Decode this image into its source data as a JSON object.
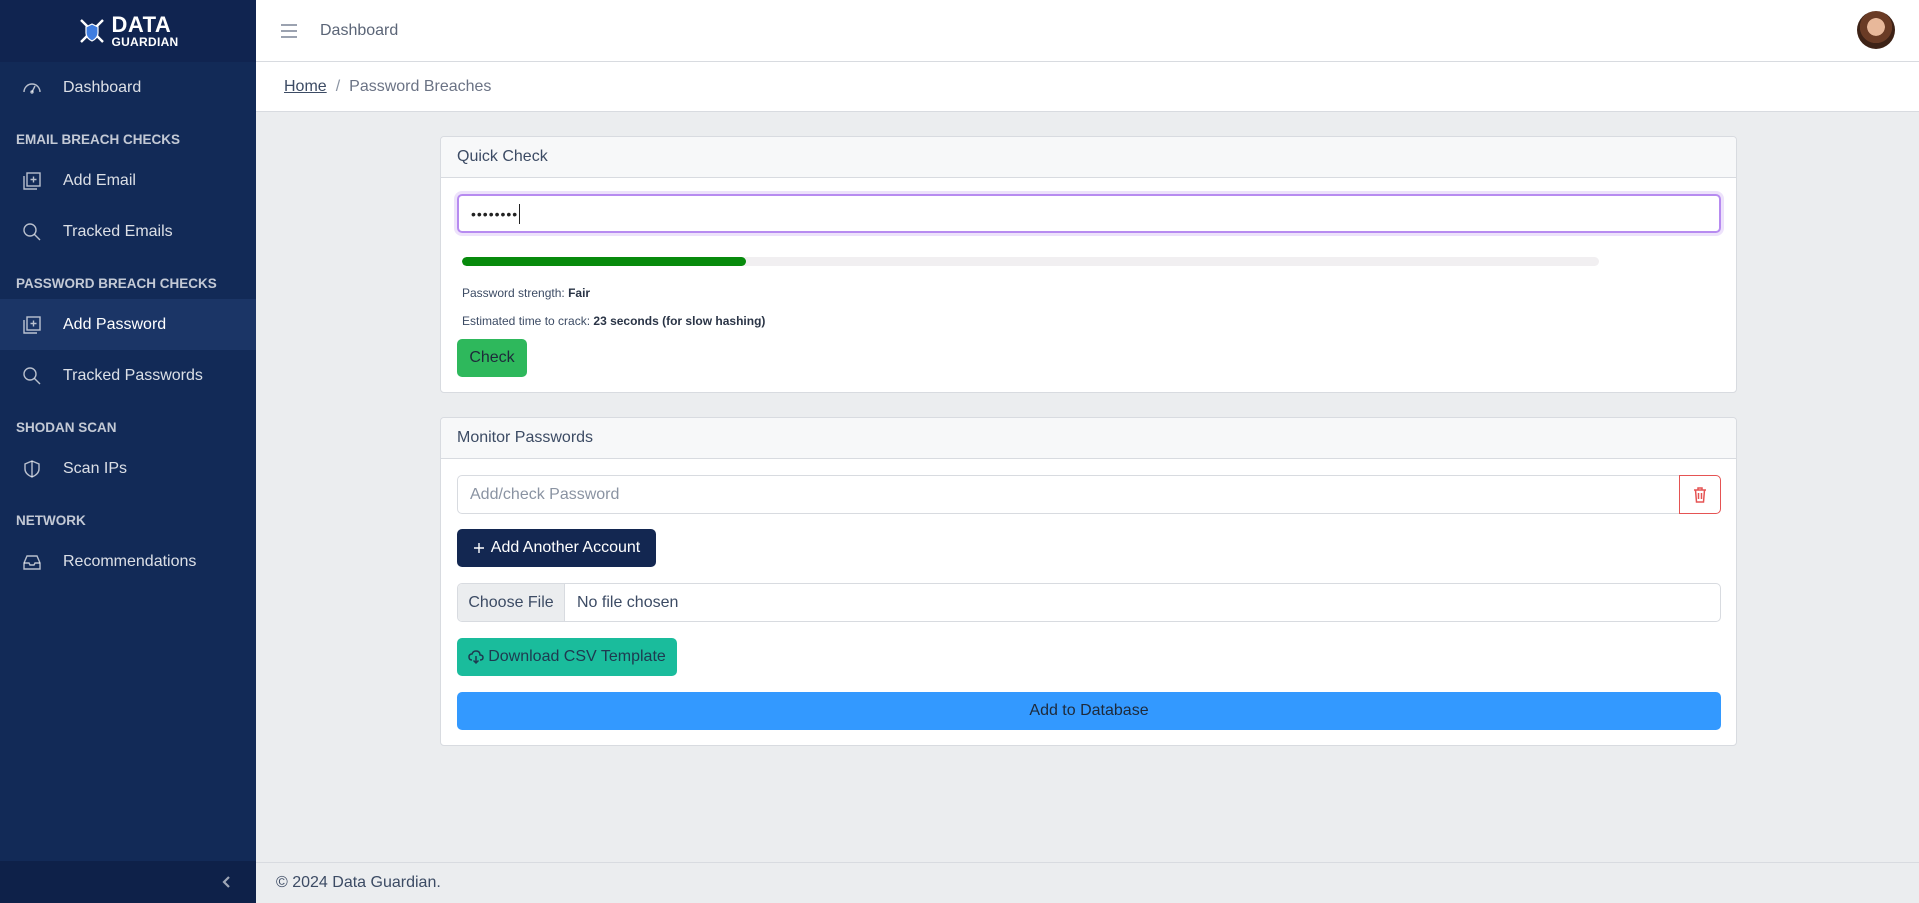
{
  "brand": {
    "logo_main": "DATA",
    "logo_sub": "GUARDIAN"
  },
  "sidebar": {
    "dashboard": {
      "label": "Dashboard",
      "icon": "speedometer-icon"
    },
    "sections": [
      {
        "title": "EMAIL BREACH CHECKS",
        "items": [
          {
            "label": "Add Email",
            "icon": "library-add-icon"
          },
          {
            "label": "Tracked Emails",
            "icon": "search-icon"
          }
        ]
      },
      {
        "title": "PASSWORD BREACH CHECKS",
        "items": [
          {
            "label": "Add Password",
            "icon": "library-add-icon",
            "active": true
          },
          {
            "label": "Tracked Passwords",
            "icon": "search-icon"
          }
        ]
      },
      {
        "title": "SHODAN SCAN",
        "items": [
          {
            "label": "Scan IPs",
            "icon": "shield-icon"
          }
        ]
      },
      {
        "title": "NETWORK",
        "items": [
          {
            "label": "Recommendations",
            "icon": "inbox-icon"
          }
        ]
      }
    ]
  },
  "header": {
    "link": "Dashboard"
  },
  "breadcrumb": {
    "home": "Home",
    "separator": "/",
    "current": "Password Breaches"
  },
  "quick_check": {
    "title": "Quick Check",
    "password_value": "••••••••",
    "strength_fraction": 0.25,
    "strength_label_prefix": "Password strength:",
    "strength_label": "Fair",
    "crack_label_prefix": "Estimated time to crack:",
    "crack_time": "23 seconds (for slow hashing)",
    "check_button": "Check"
  },
  "monitor": {
    "title": "Monitor Passwords",
    "input_placeholder": "Add/check Password",
    "add_account_button": "Add Another Account",
    "file_choose": "Choose File",
    "file_status": "No file chosen",
    "download_button": "Download CSV Template",
    "submit_button": "Add to Database"
  },
  "footer": {
    "text": "© 2024 Data Guardian."
  },
  "colors": {
    "sidebar_bg": "#122a57",
    "accent_green": "#2eb85c",
    "strength_bar": "#078a0c",
    "primary_dark": "#132751",
    "teal": "#1abc9c",
    "blue": "#3399ff",
    "danger": "#e55353"
  }
}
